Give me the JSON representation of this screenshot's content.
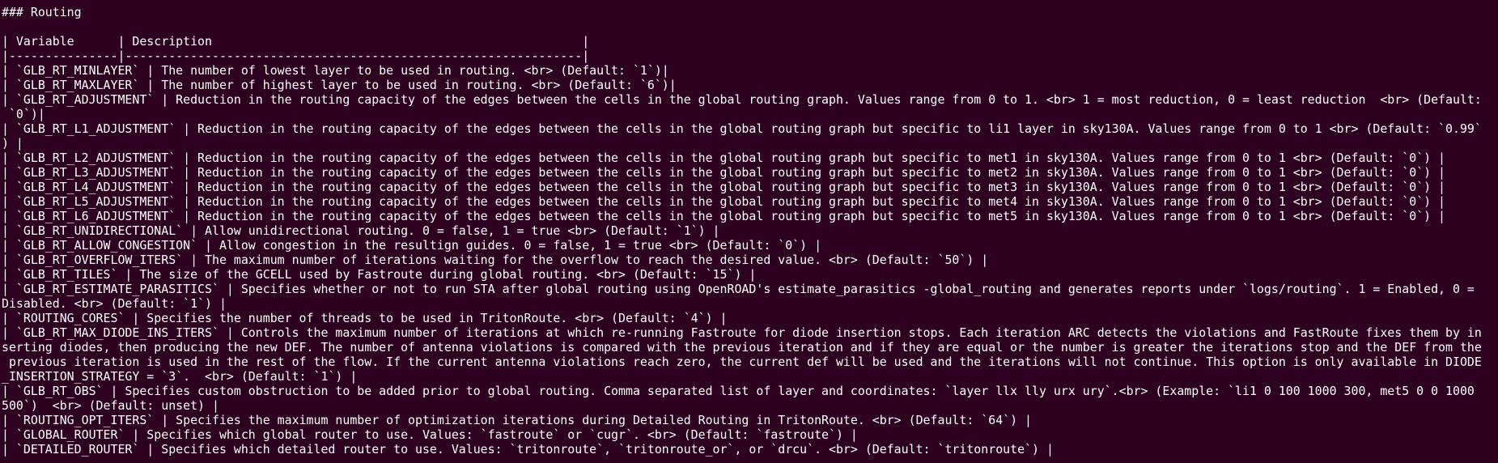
{
  "terminal": {
    "lines": [
      "### Routing",
      "",
      "| Variable      | Description                                                   |",
      "|---------------|---------------------------------------------------------------|",
      "| `GLB_RT_MINLAYER` | The number of lowest layer to be used in routing. <br> (Default: `1`)|",
      "| `GLB_RT_MAXLAYER` | The number of highest layer to be used in routing. <br> (Default: `6`)|",
      "| `GLB_RT_ADJUSTMENT` | Reduction in the routing capacity of the edges between the cells in the global routing graph. Values range from 0 to 1. <br> 1 = most reduction, 0 = least reduction  <br> (Default:",
      " `0`)|",
      "| `GLB_RT_L1_ADJUSTMENT` | Reduction in the routing capacity of the edges between the cells in the global routing graph but specific to li1 layer in sky130A. Values range from 0 to 1 <br> (Default: `0.99`",
      ") |",
      "| `GLB_RT_L2_ADJUSTMENT` | Reduction in the routing capacity of the edges between the cells in the global routing graph but specific to met1 in sky130A. Values range from 0 to 1 <br> (Default: `0`) |",
      "| `GLB_RT_L3_ADJUSTMENT` | Reduction in the routing capacity of the edges between the cells in the global routing graph but specific to met2 in sky130A. Values range from 0 to 1 <br> (Default: `0`) |",
      "| `GLB_RT_L4_ADJUSTMENT` | Reduction in the routing capacity of the edges between the cells in the global routing graph but specific to met3 in sky130A. Values range from 0 to 1 <br> (Default: `0`) |",
      "| `GLB_RT_L5_ADJUSTMENT` | Reduction in the routing capacity of the edges between the cells in the global routing graph but specific to met4 in sky130A. Values range from 0 to 1 <br> (Default: `0`) |",
      "| `GLB_RT_L6_ADJUSTMENT` | Reduction in the routing capacity of the edges between the cells in the global routing graph but specific to met5 in sky130A. Values range from 0 to 1 <br> (Default: `0`) |",
      "| `GLB_RT_UNIDIRECTIONAL` | Allow unidirectional routing. 0 = false, 1 = true <br> (Default: `1`) |",
      "| `GLB_RT_ALLOW_CONGESTION` | Allow congestion in the resultign guides. 0 = false, 1 = true <br> (Default: `0`) |",
      "| `GLB_RT_OVERFLOW_ITERS` | The maximum number of iterations waiting for the overflow to reach the desired value. <br> (Default: `50`) |",
      "| `GLB_RT_TILES` | The size of the GCELL used by Fastroute during global routing. <br> (Default: `15`) |",
      "| `GLB_RT_ESTIMATE_PARASITICS` | Specifies whether or not to run STA after global routing using OpenROAD's estimate_parasitics -global_routing and generates reports under `logs/routing`. 1 = Enabled, 0 =",
      "Disabled. <br> (Default: `1`) |",
      "| `ROUTING_CORES` | Specifies the number of threads to be used in TritonRoute. <br> (Default: `4`) |",
      "| `GLB_RT_MAX_DIODE_INS_ITERS` | Controls the maximum number of iterations at which re-running Fastroute for diode insertion stops. Each iteration ARC detects the violations and FastRoute fixes them by in",
      "serting diodes, then producing the new DEF. The number of antenna violations is compared with the previous iteration and if they are equal or the number is greater the iterations stop and the DEF from the",
      " previous iteration is used in the rest of the flow. If the current antenna violations reach zero, the current def will be used and the iterations will not continue. This option is only available in DIODE",
      "_INSERTION_STRATEGY = `3`.  <br> (Default: `1`) |",
      "| `GLB_RT_OBS` | Specifies custom obstruction to be added prior to global routing. Comma separated list of layer and coordinates: `layer llx lly urx ury`.<br> (Example: `li1 0 100 1000 300, met5 0 0 1000",
      "500`)  <br> (Default: unset) |",
      "| `ROUTING_OPT_ITERS` | Specifies the maximum number of optimization iterations during Detailed Routing in TritonRoute. <br> (Default: `64`) |",
      "| `GLOBAL_ROUTER` | Specifies which global router to use. Values: `fastroute` or `cugr`. <br> (Default: `fastroute`) |",
      "| `DETAILED_ROUTER` | Specifies which detailed router to use. Values: `tritonroute`, `tritonroute_or`, or `drcu`. <br> (Default: `tritonroute`) |"
    ]
  },
  "colors": {
    "background": "#2c001e",
    "foreground": "#ffffff"
  }
}
